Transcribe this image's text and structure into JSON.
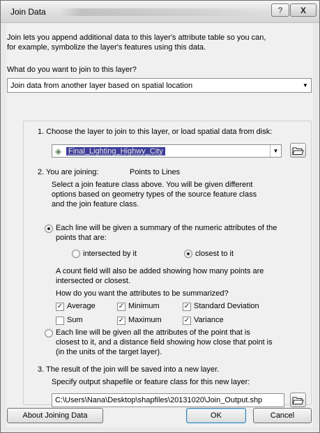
{
  "window": {
    "title": "Join Data"
  },
  "intro": {
    "line1": "Join lets you append additional data to this layer's attribute table so you can,",
    "line2": "for example, symbolize the layer's features using this data."
  },
  "join_type": {
    "question": "What do you want to join to this layer?",
    "selected": "Join data from another layer based on spatial location"
  },
  "step1": {
    "label": "1.  Choose the layer to join to this layer, or load spatial data from disk:",
    "layer": "Final_Lighting_Highwy_City"
  },
  "step2": {
    "label": "2.  You are joining:",
    "joining": "Points to Lines",
    "desc1": "Select a join feature class above.  You will be given different",
    "desc2": "options based on geometry types of the source feature class",
    "desc3": "and the join feature class.",
    "option_summary_line1": "Each line will be given a summary of the numeric attributes of the",
    "option_summary_line2": "points that are:",
    "intersected": "intersected by it",
    "closest": "closest to it",
    "count1": "A count field will also be added showing how many points are",
    "count2": "intersected or closest.",
    "how_question": "How do you want the attributes to be summarized?",
    "stats": {
      "average": "Average",
      "minimum": "Minimum",
      "std_dev": "Standard Deviation",
      "sum": "Sum",
      "maximum": "Maximum",
      "variance": "Variance"
    },
    "option_all_line1": "Each line will be given all the attributes of the point that is",
    "option_all_line2": "closest to it, and a distance field showing how close that point is",
    "option_all_line3": "(in the units of the target layer)."
  },
  "step3": {
    "label": "3.  The result of the join will be saved into a new layer.",
    "specify": "Specify output shapefile or feature class for this new layer:",
    "path": "C:\\Users\\Nana\\Desktop\\shapfiles\\20131020\\Join_Output.shp"
  },
  "buttons": {
    "about": "About Joining Data",
    "ok": "OK",
    "cancel": "Cancel"
  },
  "titlebar_buttons": {
    "help": "?",
    "close": "X"
  }
}
